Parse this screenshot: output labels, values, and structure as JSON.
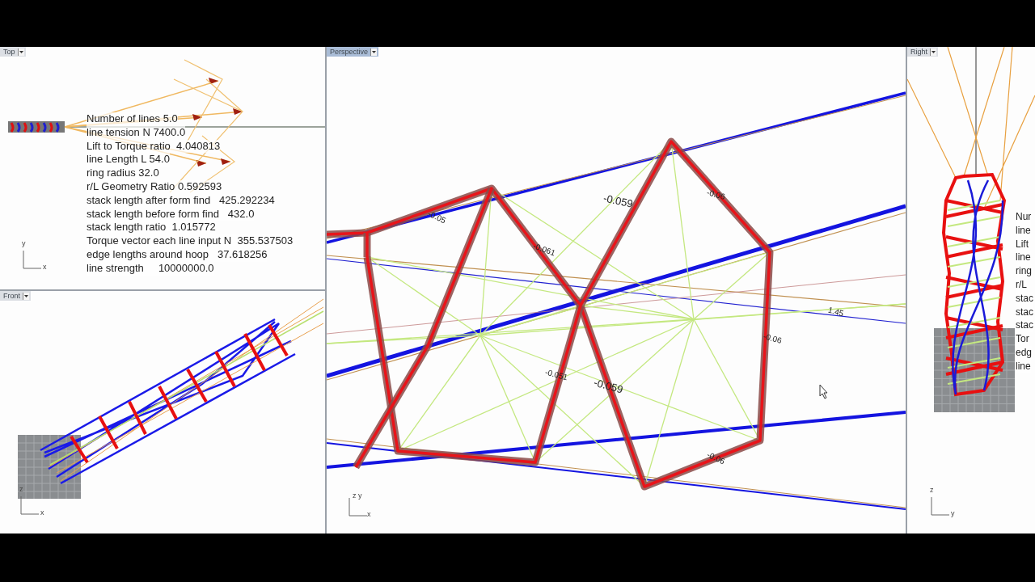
{
  "viewports": [
    {
      "kind": "top",
      "title": "Top",
      "selected": false,
      "axes": [
        "y",
        "x"
      ],
      "lines": [
        "Number of lines 5.0",
        "line tension N 7400.0",
        "Lift to Torque ratio  4.040813",
        "line Length L 54.0",
        "ring radius 32.0",
        "r/L Geometry Ratio 0.592593",
        "stack length after form find   425.292234",
        "stack length before form find   432.0",
        "stack length ratio  1.015772",
        "Torque vector each line input N  355.537503",
        "edge lengths around hoop   37.618256",
        "line strength     10000000.0"
      ]
    },
    {
      "kind": "front",
      "title": "Front",
      "selected": false,
      "axes": [
        "z",
        "x"
      ]
    },
    {
      "kind": "perspective",
      "title": "Perspective",
      "selected": true,
      "axes": [
        "z",
        "y",
        "x"
      ],
      "labels": [
        "-0.05",
        "-0.061",
        "-0.059",
        "-0.06",
        "1.45",
        "-0.051",
        "-0.059",
        "-0.06",
        "-0.06"
      ]
    },
    {
      "kind": "right",
      "title": "Right",
      "selected": false,
      "axes": [
        "z",
        "y"
      ],
      "lines": [
        "Nur",
        "line",
        "Lift",
        "line",
        "ring",
        "r/L",
        "stac",
        "stac",
        "stac",
        "Tor",
        "edg",
        "line"
      ]
    }
  ]
}
